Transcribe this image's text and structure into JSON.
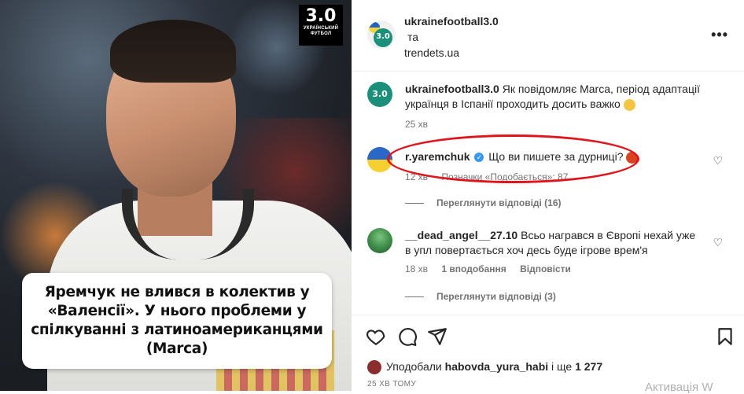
{
  "media": {
    "brand_big": "3.0",
    "brand_small_1": "УКРАЇНСЬКИЙ",
    "brand_small_2": "ФУТБОЛ",
    "caption": "Яремчук не влився в колектив у «Валенсії». У нього проблеми у спілкуванні з латиноамериканцями (Marca)"
  },
  "header": {
    "user1": "ukrainefootball3.0",
    "joiner": "та",
    "user2": "trendets.ua",
    "more_icon": "more-horizontal-icon"
  },
  "comments": [
    {
      "username": "ukrainefootball3.0",
      "text": "Як повідомляє Marca, період адаптації українця в Іспанії проходить досить важко",
      "emoji": "worried-face-emoji",
      "time": "25 хв"
    },
    {
      "username": "r.yaremchuk",
      "verified": true,
      "text": "Що ви пишете за дурниці?",
      "emoji": "angry-face-emoji",
      "time": "12 хв",
      "likes_label": "Позначки «Подобається»: 87",
      "replies_label": "Переглянути відповіді (16)"
    },
    {
      "username": "__dead_angel__27.10",
      "text": "Всьо награвся в Європі нехай уже в упл повертається хоч десь буде ігрове врем'я",
      "time": "18 хв",
      "likes_label": "1 вподобання",
      "reply_label": "Відповісти",
      "replies_label": "Переглянути відповіді (3)"
    }
  ],
  "actions": {
    "like_icon": "heart-icon",
    "comment_icon": "comment-icon",
    "share_icon": "send-icon",
    "save_icon": "bookmark-icon"
  },
  "likes": {
    "prefix": "Уподобали",
    "user": "habovda_yura_habi",
    "and": "і ще",
    "count": "1 277"
  },
  "time_ago": "25 ХВ ТОМУ",
  "watermark": "Активація W"
}
